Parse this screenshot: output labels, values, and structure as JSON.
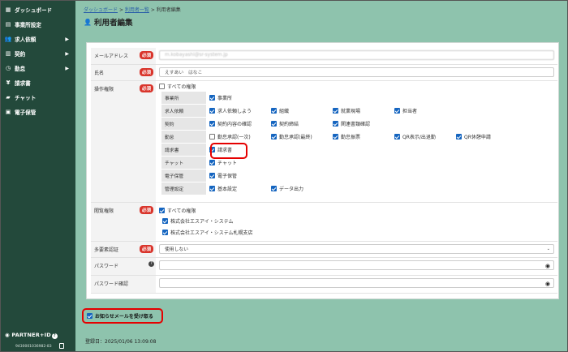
{
  "sidebar": {
    "items": [
      {
        "label": "ダッシュボード",
        "icon": "grid-icon"
      },
      {
        "label": "事業所設定",
        "icon": "building-icon"
      },
      {
        "label": "求人依頼",
        "icon": "users-icon",
        "arrow": "▶"
      },
      {
        "label": "契約",
        "icon": "document-icon",
        "arrow": "▶"
      },
      {
        "label": "勤怠",
        "icon": "clock-icon",
        "arrow": "▶"
      },
      {
        "label": "請求書",
        "icon": "yen-icon"
      },
      {
        "label": "チャット",
        "icon": "chat-icon"
      },
      {
        "label": "電子保管",
        "icon": "archive-icon"
      }
    ],
    "brand": "PARTNER+ID",
    "brand_help": "?",
    "brand_id": "9430001036982-83"
  },
  "breadcrumb": {
    "home": "ダッシュボード",
    "sep1": ">",
    "list": "利用者一覧",
    "sep2": ">",
    "current": "利用者編集"
  },
  "page_title": "利用者編集",
  "required_label": "必須",
  "form": {
    "email": {
      "label": "メールアドレス",
      "value": "m.kobayashi@sr-system.jp"
    },
    "name": {
      "label": "氏名",
      "value": "えすあい　はなこ"
    },
    "permissions": {
      "label": "操作権限",
      "all_label": "すべての権限",
      "rows": [
        {
          "category": "事業所",
          "options": [
            {
              "label": "事業所",
              "checked": true
            }
          ]
        },
        {
          "category": "求人依頼",
          "options": [
            {
              "label": "求人依頼しよう",
              "checked": true
            },
            {
              "label": "組織",
              "checked": true
            },
            {
              "label": "就業現場",
              "checked": true
            },
            {
              "label": "担当者",
              "checked": true
            }
          ]
        },
        {
          "category": "契約",
          "options": [
            {
              "label": "契約内容の確認",
              "checked": true
            },
            {
              "label": "契約締結",
              "checked": true
            },
            {
              "label": "関連書類確認",
              "checked": true
            }
          ]
        },
        {
          "category": "勤怠",
          "options": [
            {
              "label": "勤怠承認(一次)",
              "checked": false
            },
            {
              "label": "勤怠承認(最終)",
              "checked": true
            },
            {
              "label": "勤怠振票",
              "checked": true
            },
            {
              "label": "QR表示/出退勤",
              "checked": true
            },
            {
              "label": "QR休憩申請",
              "checked": true
            }
          ]
        },
        {
          "category": "請求書",
          "options": [
            {
              "label": "請求書",
              "checked": true
            }
          ]
        },
        {
          "category": "チャット",
          "options": [
            {
              "label": "チャット",
              "checked": true
            }
          ]
        },
        {
          "category": "電子保管",
          "options": [
            {
              "label": "電子保管",
              "checked": true
            }
          ]
        },
        {
          "category": "管理設定",
          "options": [
            {
              "label": "基本設定",
              "checked": true
            },
            {
              "label": "データ出力",
              "checked": true
            }
          ]
        }
      ]
    },
    "view": {
      "label": "閲覧権限",
      "options": [
        {
          "label": "すべての権限",
          "checked": true
        },
        {
          "label": "株式会社エスアイ・システム",
          "checked": true
        },
        {
          "label": "株式会社エスアイ・システム札幌支店",
          "checked": true
        }
      ]
    },
    "mfa": {
      "label": "多要素認証",
      "value": "使用しない"
    },
    "password": {
      "label": "パスワード",
      "help": "?"
    },
    "password_confirm": {
      "label": "パスワード確認"
    }
  },
  "notify": {
    "label": "お知らせメールを受け取る",
    "checked": true
  },
  "registered": "登録日：2025/01/06 13:09:08",
  "colors": {
    "sidebar": "#23493b",
    "main_bg": "#8ec3ad",
    "required": "#d9342b",
    "checkbox": "#1565c0",
    "highlight": "#e50000"
  }
}
